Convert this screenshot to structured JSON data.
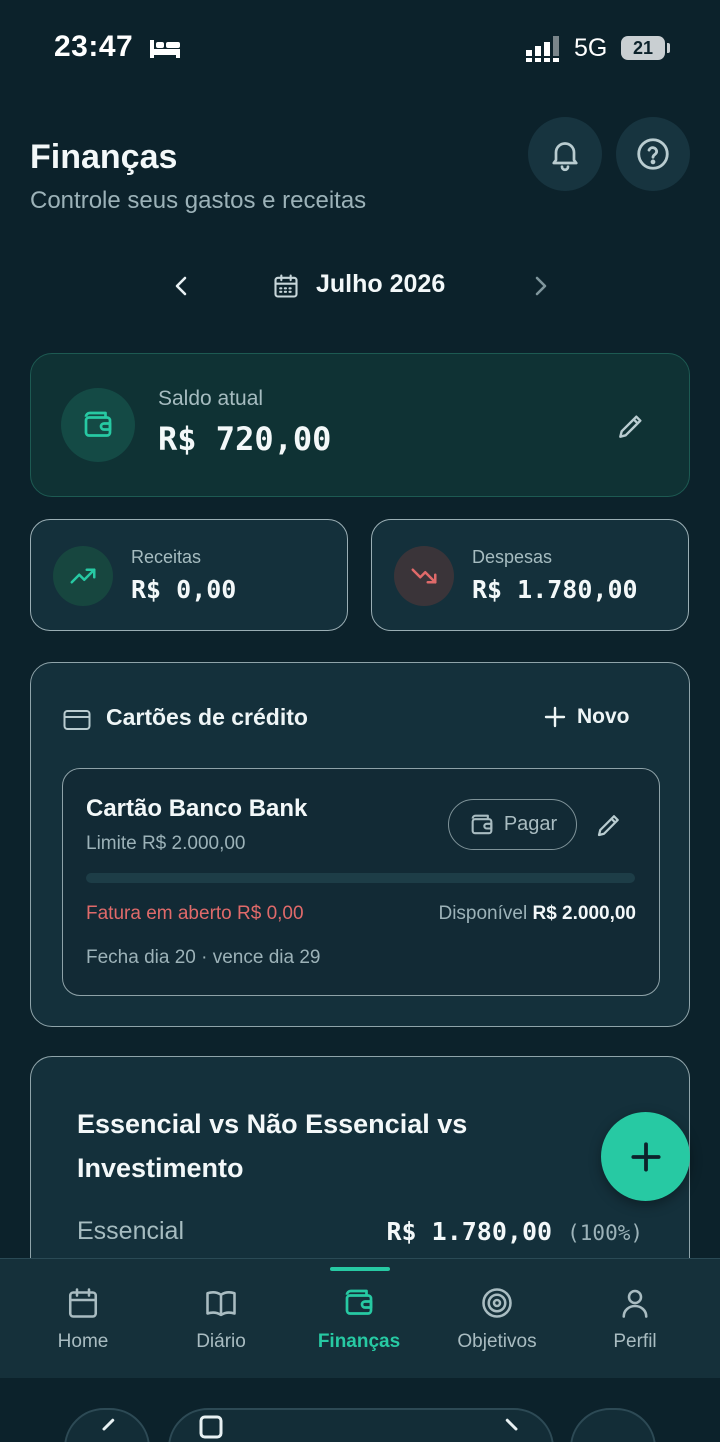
{
  "status_bar": {
    "time": "23:47",
    "network": "5G",
    "battery": "21"
  },
  "header": {
    "title": "Finanças",
    "subtitle": "Controle seus gastos e receitas"
  },
  "month_selector": {
    "label": "Julho 2026"
  },
  "balance": {
    "label": "Saldo atual",
    "value": "R$ 720,00"
  },
  "income": {
    "label": "Receitas",
    "value": "R$ 0,00"
  },
  "expenses": {
    "label": "Despesas",
    "value": "R$ 1.780,00"
  },
  "credit_cards": {
    "title": "Cartões de crédito",
    "new_label": "Novo",
    "card": {
      "name": "Cartão Banco Bank",
      "limit": "Limite R$ 2.000,00",
      "pay_label": "Pagar",
      "usage_fraction": 0,
      "open_bill": "Fatura em aberto R$ 0,00",
      "available_label": "Disponível",
      "available_value": "R$ 2.000,00",
      "dates": "Fecha dia 20 · vence dia 29"
    }
  },
  "breakdown": {
    "title": "Essencial vs Não Essencial vs Investimento",
    "rows": [
      {
        "label": "Essencial",
        "value": "R$ 1.780,00",
        "percent": "(100%)"
      }
    ]
  },
  "nav": {
    "items": [
      {
        "label": "Home",
        "icon": "calendar-icon"
      },
      {
        "label": "Diário",
        "icon": "book-icon"
      },
      {
        "label": "Finanças",
        "icon": "wallet-icon",
        "active": true
      },
      {
        "label": "Objetivos",
        "icon": "target-icon"
      },
      {
        "label": "Perfil",
        "icon": "user-icon"
      }
    ]
  },
  "colors": {
    "accent": "#27c9a3",
    "background": "#0c222b",
    "card": "#14303b",
    "danger": "#e06a6a"
  }
}
